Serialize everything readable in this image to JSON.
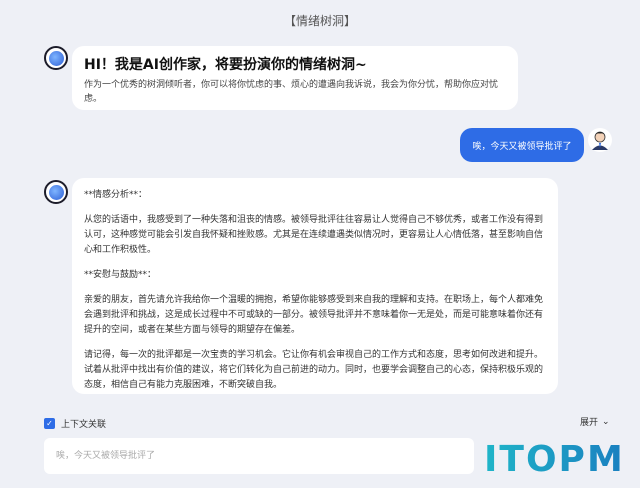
{
  "header": {
    "title": "【情绪树洞】"
  },
  "greeting": {
    "title": "HI！我是AI创作家，将要扮演你的情绪树洞~",
    "description": "作为一个优秀的树洞倾听者，你可以将你忧虑的事、烦心的遭遇向我诉说，我会为你分忧，帮助你应对忧虑。"
  },
  "user_message": {
    "text": "唉，今天又被领导批评了"
  },
  "reply": {
    "paragraphs": [
      "**情感分析**：",
      "从您的话语中，我感受到了一种失落和沮丧的情感。被领导批评往往容易让人觉得自己不够优秀，或者工作没有得到认可，这种感觉可能会引发自我怀疑和挫败感。尤其是在连续遭遇类似情况时，更容易让人心情低落，甚至影响自信心和工作积极性。",
      "**安慰与鼓励**：",
      "亲爱的朋友，首先请允许我给你一个温暖的拥抱，希望你能够感受到来自我的理解和支持。在职场上，每个人都难免会遇到批评和挑战，这是成长过程中不可或缺的一部分。被领导批评并不意味着你一无是处，而是可能意味着你还有提升的空间，或者在某些方面与领导的期望存在偏差。",
      "请记得，每一次的批评都是一次宝贵的学习机会。它让你有机会审视自己的工作方式和态度，思考如何改进和提升。试着从批评中找出有价值的建议，将它们转化为自己前进的动力。同时，也要学会调整自己的心态，保持积极乐观的态度，相信自己有能力克服困难，不断突破自我。"
    ]
  },
  "footer": {
    "context_label": "上下文关联",
    "expand_label": "展开",
    "input_placeholder": "唉，今天又被领导批评了",
    "brand_text": "ITOPM"
  },
  "colors": {
    "accent": "#2e6ce6",
    "background": "#eef0f6",
    "brand": "#1aa8c8"
  }
}
